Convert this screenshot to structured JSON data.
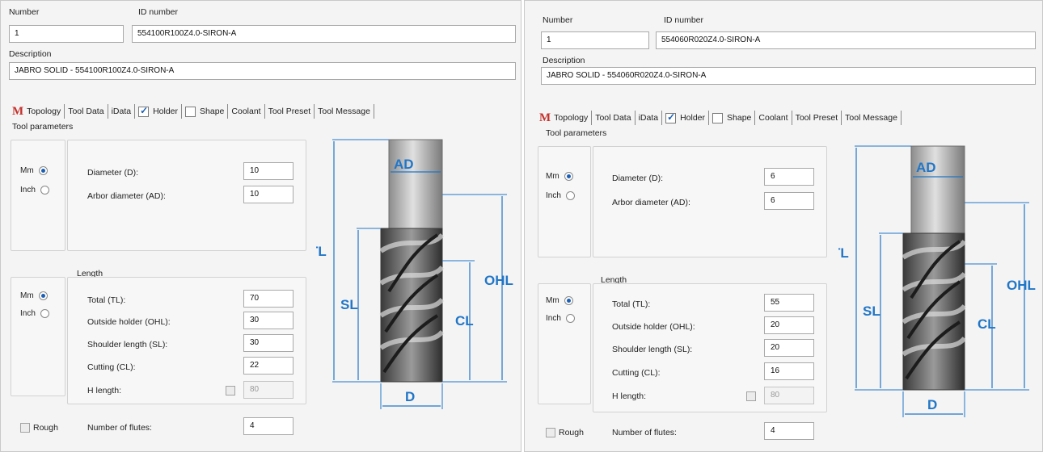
{
  "labels": {
    "number": "Number",
    "id_number": "ID number",
    "description": "Description"
  },
  "tabs": [
    "Topology",
    "Tool Data",
    "iData",
    "Holder",
    "Shape",
    "Coolant",
    "Tool Preset",
    "Tool Message"
  ],
  "tab_checked": {
    "holder": true,
    "shape": false
  },
  "group_titles": {
    "tool_parameters": "Tool parameters",
    "length": "Length"
  },
  "units": {
    "mm": "Mm",
    "inch": "Inch"
  },
  "param_labels": {
    "diameter": "Diameter (D):",
    "arbor_diameter": "Arbor diameter (AD):",
    "total": "Total (TL):",
    "outside_holder": "Outside holder (OHL):",
    "shoulder_length": "Shoulder length (SL):",
    "cutting": "Cutting (CL):",
    "h_length": "H length:",
    "rough": "Rough",
    "flutes": "Number of flutes:"
  },
  "diagram_labels": {
    "ad": "AD",
    "tl": "TL",
    "sl": "SL",
    "ohl": "OHL",
    "cl": "CL",
    "d": "D"
  },
  "accent_color": "#2176c7",
  "tools": [
    {
      "number": "1",
      "id_number": "554100R100Z4.0-SIRON-A",
      "description": "JABRO SOLID - 554100R100Z4.0-SIRON-A",
      "diameter": "10",
      "arbor_diameter": "10",
      "total": "70",
      "outside_holder": "30",
      "shoulder_length": "30",
      "cutting": "22",
      "h_length": "80",
      "flutes": "4"
    },
    {
      "number": "1",
      "id_number": "554060R020Z4.0-SIRON-A",
      "description": "JABRO SOLID - 554060R020Z4.0-SIRON-A",
      "diameter": "6",
      "arbor_diameter": "6",
      "total": "55",
      "outside_holder": "20",
      "shoulder_length": "20",
      "cutting": "16",
      "h_length": "80",
      "flutes": "4"
    }
  ]
}
